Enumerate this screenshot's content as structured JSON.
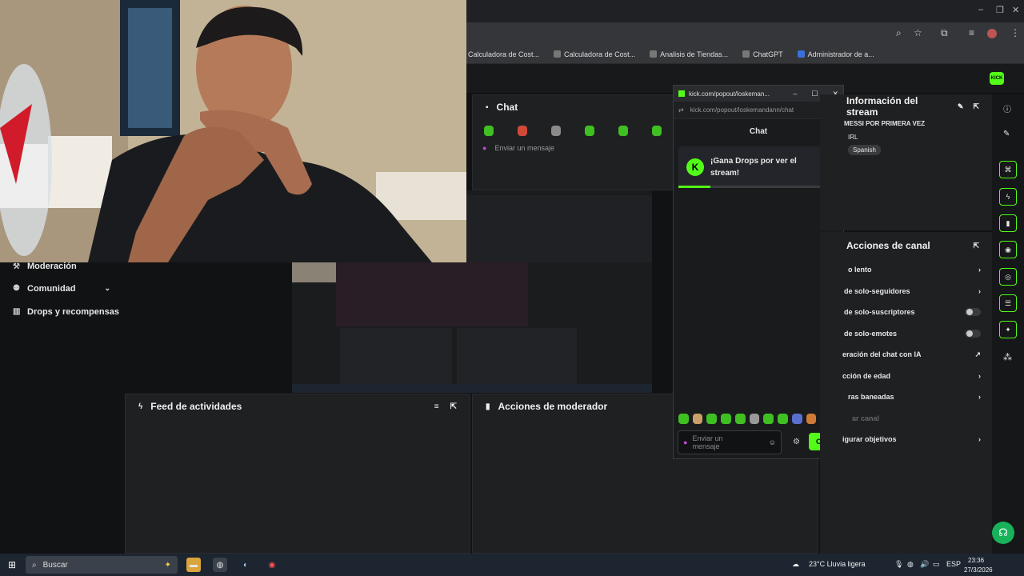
{
  "bookmarks": [
    {
      "label": "Calculadora de Cost..."
    },
    {
      "label": "Calculadora de Cost..."
    },
    {
      "label": "Analisis de Tiendas..."
    },
    {
      "label": "ChatGPT"
    },
    {
      "label": "Administrador de a..."
    }
  ],
  "left_nav": {
    "items": [
      {
        "label": "Moderación"
      },
      {
        "label": "Comunidad"
      },
      {
        "label": "Drops y recompensas"
      }
    ]
  },
  "chat_panel": {
    "title": "Chat",
    "input_placeholder": "Enviar un mensaje"
  },
  "feed_panel": {
    "title": "Feed de actividades"
  },
  "mod_panel": {
    "title": "Acciones de moderador"
  },
  "popup": {
    "window_title": "kick.com/popout/loskeman...",
    "url": "kick.com/popout/loskemandann/chat",
    "tab": "Chat",
    "drops_text": "¡Gana Drops por ver el stream!",
    "drops_progress": 0.2,
    "input_placeholder": "Enviar un mensaje",
    "send_label": "Chat"
  },
  "stream_info": {
    "title": "Información del stream",
    "stream_title": "MESSI POR PRIMERA VEZ",
    "category": "IRL",
    "language": "Spanish"
  },
  "channel_actions": {
    "title": "Acciones de canal",
    "items": [
      {
        "label": "o lento",
        "control": "chevron"
      },
      {
        "label": "de solo-seguidores",
        "control": "chevron"
      },
      {
        "label": "de solo-suscriptores",
        "control": "toggle"
      },
      {
        "label": "de solo-emotes",
        "control": "toggle"
      },
      {
        "label": "eración del chat con IA",
        "control": "chart"
      },
      {
        "label": "cción de edad",
        "control": "chevron"
      },
      {
        "label": "ras baneadas",
        "control": "chevron"
      },
      {
        "label": "ar canal",
        "control": "none"
      },
      {
        "label": "igurar objetivos",
        "control": "chevron"
      }
    ]
  },
  "taskbar": {
    "search_placeholder": "Buscar",
    "weather": "23°C  Lluvia ligera",
    "lang": "ESP",
    "time": "23:36",
    "date": "27/3/2026"
  },
  "colors": {
    "accent": "#53fc18",
    "panel": "#1f2022",
    "bg": "#111213"
  }
}
